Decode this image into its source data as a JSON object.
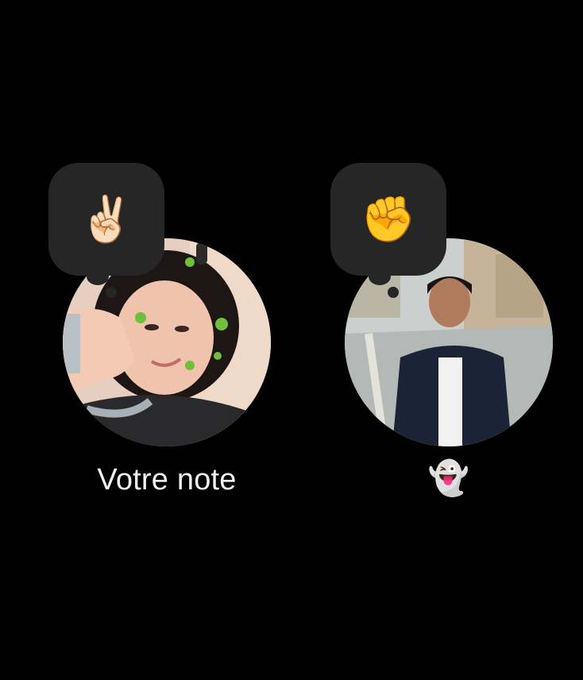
{
  "notes": [
    {
      "owner": "you",
      "note_emoji": "✌🏻",
      "caption": "Votre note"
    },
    {
      "owner": "friend",
      "note_emoji": "✊",
      "caption": "👻"
    }
  ],
  "colors": {
    "background": "#000000",
    "bubble": "#262626",
    "caption_text": "#f2f2f2"
  }
}
